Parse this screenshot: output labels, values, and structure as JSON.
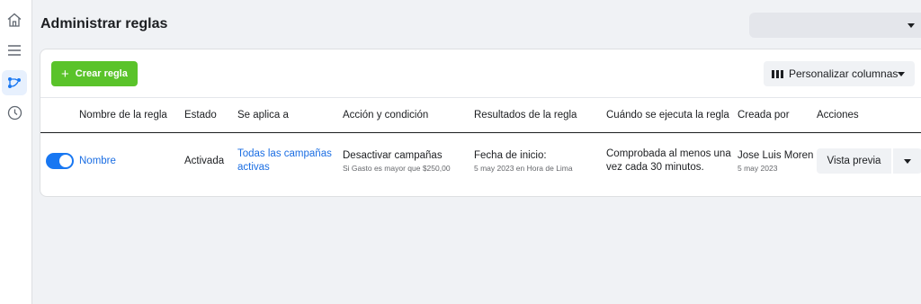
{
  "nav": {
    "items": [
      {
        "name": "home-icon"
      },
      {
        "name": "menu-icon"
      },
      {
        "name": "rules-icon",
        "active": true
      },
      {
        "name": "clock-icon"
      }
    ]
  },
  "header": {
    "title": "Administrar reglas",
    "account_selector": {
      "value": "",
      "icon": "caret-down-icon"
    }
  },
  "toolbar": {
    "create_label": "Crear regla",
    "create_icon": "plus-icon",
    "columns_label": "Personalizar columnas",
    "columns_icon": "columns-icon"
  },
  "table": {
    "columns": [
      "Nombre de la regla",
      "Estado",
      "Se aplica a",
      "Acción y condición",
      "Resultados de la regla",
      "Cuándo se ejecuta la regla",
      "Creada por",
      "Acciones"
    ],
    "rows": [
      {
        "toggle_on": true,
        "name": "Nombre",
        "status": "Activada",
        "applies_to": [
          "Todas las campañas",
          "activas"
        ],
        "action": "Desactivar campañas",
        "condition": "Si Gasto es mayor que $250,00",
        "results": "Fecha de inicio:",
        "results_sub": "5 may 2023 en Hora de Lima",
        "schedule": [
          "Comprobada al menos una",
          "vez cada 30 minutos."
        ],
        "created_by": "Jose Luis Moren",
        "created_date": "5 may 2023",
        "preview_label": "Vista previa"
      }
    ]
  },
  "colors": {
    "accent_blue": "#1877f2",
    "link_blue": "#1b6ee3",
    "create_green": "#5ac32a",
    "background": "#f0f2f5"
  }
}
